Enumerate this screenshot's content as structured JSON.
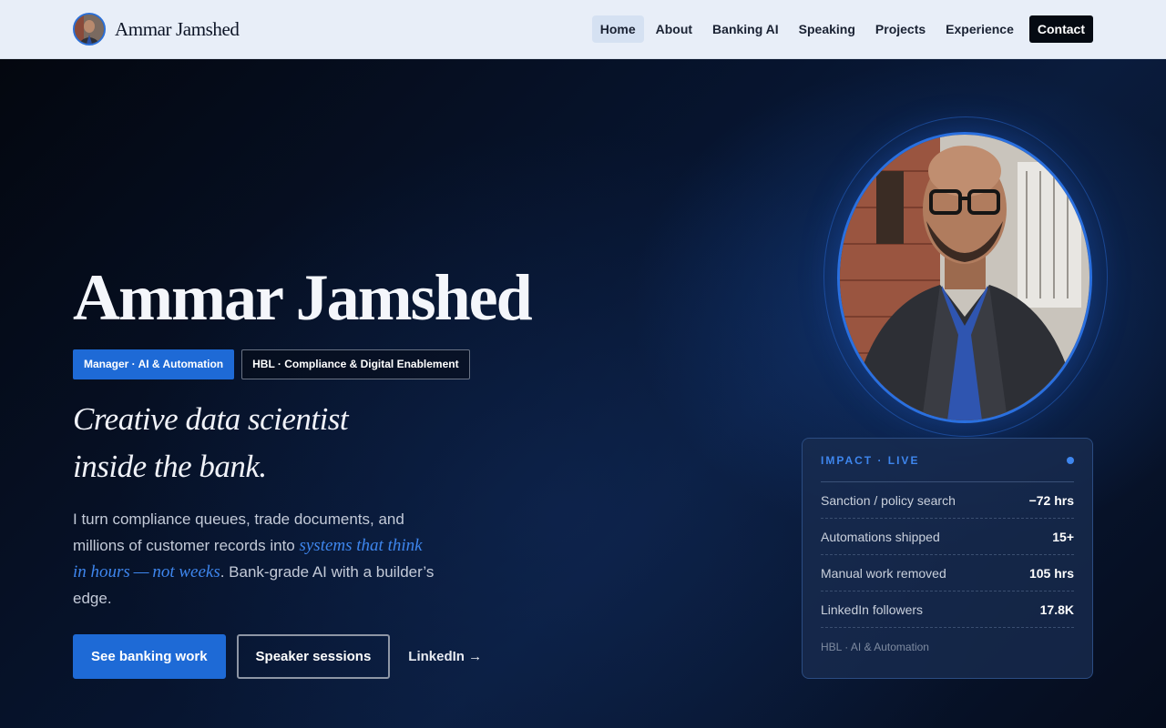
{
  "nav": {
    "brand_name": "Ammar Jamshed",
    "items": [
      {
        "label": "Home",
        "active": true
      },
      {
        "label": "About"
      },
      {
        "label": "Banking AI"
      },
      {
        "label": "Speaking"
      },
      {
        "label": "Projects"
      },
      {
        "label": "Experience"
      }
    ],
    "contact_label": "Contact"
  },
  "hero": {
    "name": "Ammar Jamshed",
    "tags": [
      "Manager · AI & Automation",
      "HBL · Compliance & Digital Enablement"
    ],
    "tagline_line1": "Creative data scientist",
    "tagline_line2": "inside the bank.",
    "intro_before": "I turn compliance queues, trade documents, and millions of customer records into ",
    "intro_highlight": "systems that think in hours — not weeks",
    "intro_after": ". Bank-grade AI with a builder’s edge.",
    "cta_primary": "See banking work",
    "cta_secondary": "Speaker sessions",
    "cta_link": "LinkedIn →"
  },
  "impact": {
    "title": "IMPACT · LIVE",
    "stats": [
      {
        "label": "Sanction / policy search",
        "value": "−72 hrs"
      },
      {
        "label": "Automations shipped",
        "value": "15+"
      },
      {
        "label": "Manual work removed",
        "value": "105 hrs"
      },
      {
        "label": "LinkedIn followers",
        "value": "17.8K"
      }
    ],
    "footer": "HBL · AI & Automation"
  },
  "colors": {
    "accent": "#1e6ad6",
    "accent_light": "#3e86ee",
    "background_dark": "#050b18",
    "nav_bg": "#e8eef8"
  },
  "icons": {
    "brand": "avatar-photo",
    "live": "live-dot-icon",
    "link_arrow": "arrow-right-icon"
  }
}
